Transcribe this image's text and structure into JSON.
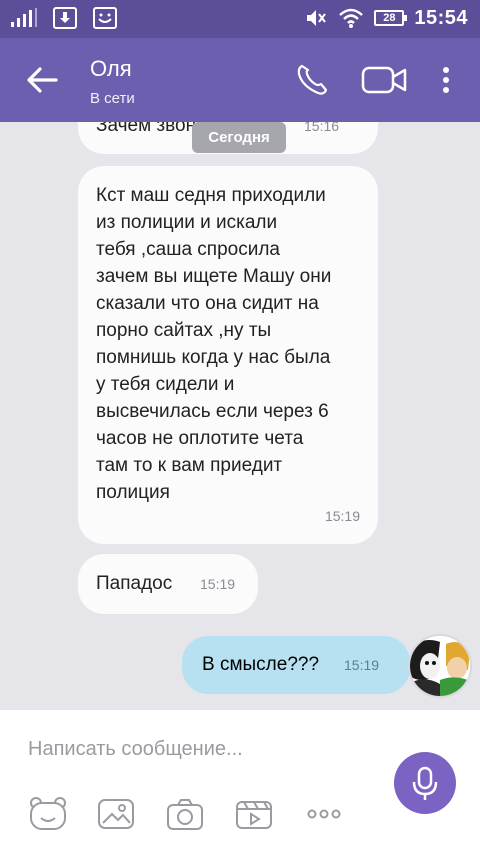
{
  "status_bar": {
    "time": "15:54",
    "battery": "28",
    "icons": [
      "signal-icon",
      "download-notification-icon",
      "viber-notification-icon",
      "mute-icon",
      "wifi-icon",
      "battery-icon"
    ]
  },
  "header": {
    "contact_name": "Оля",
    "contact_status": "В сети",
    "icons": [
      "back-arrow-icon",
      "phone-icon",
      "video-call-icon",
      "more-vert-icon"
    ]
  },
  "messages": {
    "partial_text": "Зачем звонила та?",
    "partial_time": "15:16",
    "date_separator": "Сегодня",
    "msg1_lines": [
      "Кст маш седня приходили",
      "из полиции и искали",
      "тебя ,саша спросила",
      "зачем вы ищете Машу они",
      "сказали что она сидит на",
      "порно сайтах ,ну ты",
      "помнишь когда у нас была",
      "у тебя сидели и",
      "высвечилась если через 6",
      "часов не оплотите чета",
      "там то к вам приедит",
      "полиция"
    ],
    "msg1_time": "15:19",
    "msg2_text": "Пападос",
    "msg2_time": "15:19",
    "msg3_text": "В смысле???",
    "msg3_time": "15:19"
  },
  "composer": {
    "placeholder": "Написать сообщение...",
    "tools": [
      "sticker-icon",
      "gallery-icon",
      "camera-icon",
      "gif-icon",
      "more-icon"
    ],
    "mic": "microphone-icon"
  },
  "colors": {
    "status_bar": "#5c4e98",
    "app_bar": "#6d5fb0",
    "chat_bg": "#e6e6ea",
    "incoming_bubble": "#fbfbfc",
    "outgoing_bubble": "#b7e0f1",
    "mic_button": "#7a63c2"
  }
}
